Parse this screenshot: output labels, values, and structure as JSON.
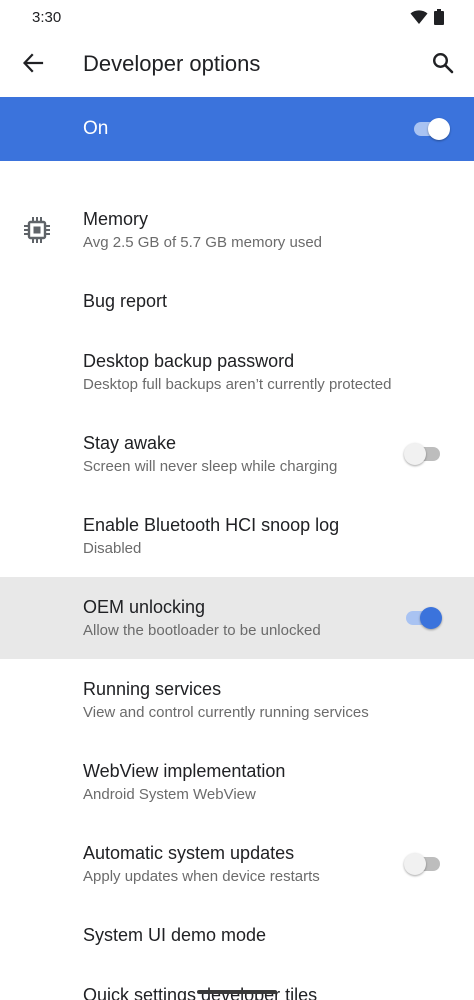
{
  "status_bar": {
    "time": "3:30",
    "icons": [
      "wifi-icon",
      "battery-icon"
    ]
  },
  "app_bar": {
    "title": "Developer options",
    "back_icon": "back-arrow-icon",
    "search_icon": "search-icon"
  },
  "master": {
    "label": "On",
    "enabled": true
  },
  "colors": {
    "accent": "#3b73dc",
    "accent_track": "#a9c3f2",
    "highlight": "#e8e8e8",
    "secondary_text": "#6b6b6b"
  },
  "items": [
    {
      "title": "Memory",
      "subtitle": "Avg 2.5 GB of 5.7 GB memory used",
      "icon": "memory-chip-icon"
    },
    {
      "title": "Bug report",
      "subtitle": ""
    },
    {
      "title": "Desktop backup password",
      "subtitle": "Desktop full backups aren’t currently protected"
    },
    {
      "title": "Stay awake",
      "subtitle": "Screen will never sleep while charging",
      "toggle": false
    },
    {
      "title": "Enable Bluetooth HCI snoop log",
      "subtitle": "Disabled"
    },
    {
      "title": "OEM unlocking",
      "subtitle": "Allow the bootloader to be unlocked",
      "toggle": true,
      "highlighted": true
    },
    {
      "title": "Running services",
      "subtitle": "View and control currently running services"
    },
    {
      "title": "WebView implementation",
      "subtitle": "Android System WebView"
    },
    {
      "title": "Automatic system updates",
      "subtitle": "Apply updates when device restarts",
      "toggle": false
    },
    {
      "title": "System UI demo mode",
      "subtitle": ""
    },
    {
      "title": "Quick settings developer tiles",
      "subtitle": ""
    }
  ]
}
